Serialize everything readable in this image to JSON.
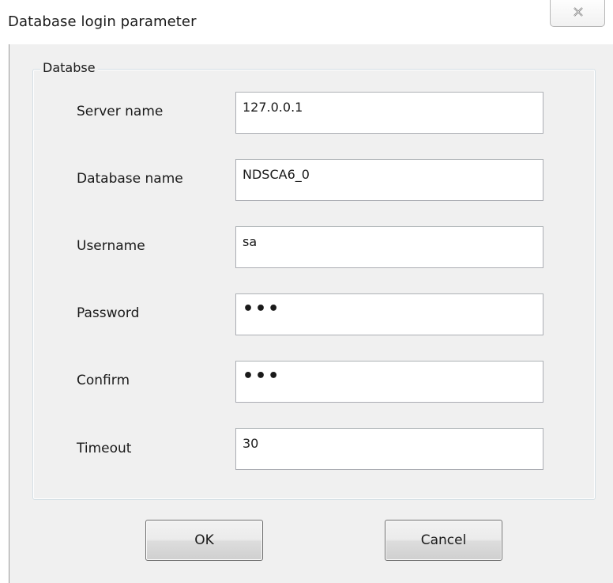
{
  "window": {
    "title": "Database login parameter"
  },
  "group": {
    "label": "Databse"
  },
  "fields": [
    {
      "label": "Server name",
      "value": "127.0.0.1"
    },
    {
      "label": "Database name",
      "value": "NDSCA6_0"
    },
    {
      "label": "Username",
      "value": "sa"
    },
    {
      "label": "Password",
      "value": "•••"
    },
    {
      "label": "Confirm",
      "value": "•••"
    },
    {
      "label": "Timeout",
      "value": "30"
    }
  ],
  "buttons": {
    "ok_label": "OK",
    "cancel_label": "Cancel"
  },
  "icons": {
    "close": "close-icon"
  }
}
